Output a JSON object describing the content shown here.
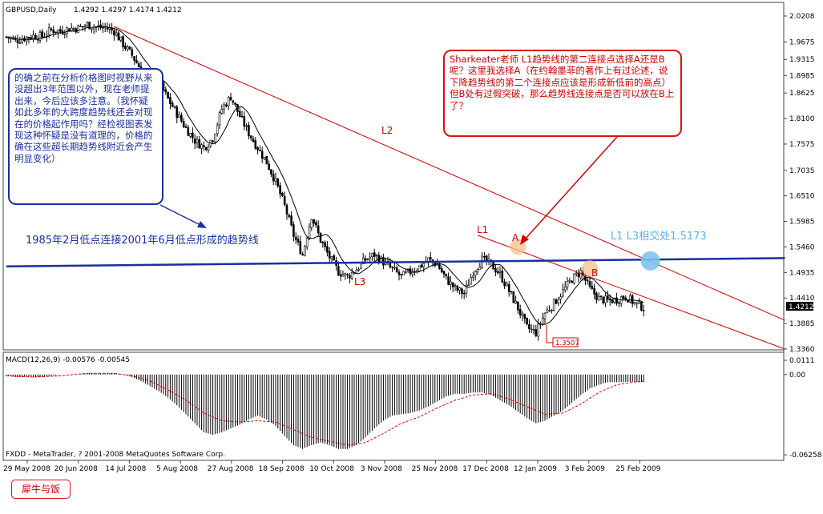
{
  "window": {
    "title": "GBPUSD,Daily",
    "ohlc": "1.4292 1.4297 1.4174 1.4212",
    "current_price": "1.4212",
    "footer": "FXDD - MetaTrader, ? 2001-2008 MetaQuotes Software Corp."
  },
  "annotations": {
    "left_note": "的确之前在分析价格图时视野从来没超出3年范围以外，现在老师提出来，今后应该多注意。（我怀疑如此多年的大跨度趋势线还会对现在的价格起作用吗？经检视图表发现这种怀疑是没有道理的，价格的确在这些超长期趋势线附近会产生明显变化）",
    "right_note": "Sharkeater老师 L1趋势线的第二连接点选择A还是B呢？这里我选择A（在约翰墨菲的著作上有过论述，说下降趋势线的第二个连接点应该是形成新低前的高点）但B处有过假突破，那么趋势线连接点是否可以放在B上了？",
    "blue_line_label": "1985年2月低点连接2001年6月低点形成的趋势线",
    "intersection_label": "L1 L3相交处1.5173",
    "label_L1": "L1",
    "label_L2": "L2",
    "label_L3": "L3",
    "label_A": "A",
    "label_B": "B",
    "low_label": "1.3507",
    "signature": "犀牛与饭"
  },
  "colors": {
    "bull_candle": "#ffffff",
    "bear_candle": "#000000",
    "moving_average": "#000000",
    "trend_red": "#d40000",
    "trend_blue": "#1a2fa0",
    "intersection": "#7ec3ef",
    "highlight": "#f5c08a",
    "macd_signal": "#e00000"
  },
  "chart_data": [
    {
      "type": "candlestick",
      "title": "GBPUSD,Daily",
      "ylim": [
        1.336,
        2.0208
      ],
      "y_ticks": [
        "2.0208",
        "1.9675",
        "1.9315",
        "1.8985",
        "1.8625",
        "1.8100",
        "1.7575",
        "1.7035",
        "1.6510",
        "1.5985",
        "1.5460",
        "1.4935",
        "1.4410",
        "1.3885",
        "1.3360"
      ],
      "x_ticks": [
        "29 May 2008",
        "20 Jun 2008",
        "14 Jul 2008",
        "5 Aug 2008",
        "27 Aug 2008",
        "18 Sep 2008",
        "10 Oct 2008",
        "3 Nov 2008",
        "25 Nov 2008",
        "17 Dec 2008",
        "12 Jan 2009",
        "3 Feb 2009",
        "25 Feb 2009"
      ],
      "close_path": [
        [
          0,
          1.978
        ],
        [
          4,
          1.97
        ],
        [
          8,
          1.976
        ],
        [
          12,
          1.98
        ],
        [
          16,
          1.979
        ],
        [
          20,
          1.992
        ],
        [
          24,
          1.99
        ],
        [
          28,
          1.995
        ],
        [
          32,
          1.996
        ],
        [
          36,
          2.003
        ],
        [
          40,
          1.998
        ],
        [
          44,
          1.997
        ],
        [
          48,
          1.99
        ],
        [
          52,
          1.963
        ],
        [
          56,
          1.94
        ],
        [
          60,
          1.91
        ],
        [
          64,
          1.885
        ],
        [
          68,
          1.885
        ],
        [
          72,
          1.85
        ],
        [
          76,
          1.82
        ],
        [
          80,
          1.79
        ],
        [
          84,
          1.765
        ],
        [
          88,
          1.75
        ],
        [
          92,
          1.77
        ],
        [
          96,
          1.83
        ],
        [
          100,
          1.855
        ],
        [
          104,
          1.815
        ],
        [
          108,
          1.78
        ],
        [
          112,
          1.75
        ],
        [
          116,
          1.72
        ],
        [
          120,
          1.68
        ],
        [
          124,
          1.63
        ],
        [
          128,
          1.57
        ],
        [
          132,
          1.53
        ],
        [
          136,
          1.61
        ],
        [
          140,
          1.56
        ],
        [
          144,
          1.525
        ],
        [
          148,
          1.495
        ],
        [
          152,
          1.485
        ],
        [
          156,
          1.5
        ],
        [
          160,
          1.52
        ],
        [
          164,
          1.53
        ],
        [
          168,
          1.515
        ],
        [
          172,
          1.5
        ],
        [
          176,
          1.485
        ],
        [
          180,
          1.495
        ],
        [
          184,
          1.505
        ],
        [
          188,
          1.52
        ],
        [
          192,
          1.51
        ],
        [
          196,
          1.48
        ],
        [
          200,
          1.46
        ],
        [
          204,
          1.45
        ],
        [
          208,
          1.495
        ],
        [
          212,
          1.52
        ],
        [
          216,
          1.51
        ],
        [
          220,
          1.49
        ],
        [
          224,
          1.455
        ],
        [
          228,
          1.42
        ],
        [
          232,
          1.38
        ],
        [
          236,
          1.37
        ],
        [
          240,
          1.41
        ],
        [
          244,
          1.43
        ],
        [
          248,
          1.455
        ],
        [
          252,
          1.48
        ],
        [
          256,
          1.495
        ],
        [
          260,
          1.46
        ],
        [
          264,
          1.44
        ],
        [
          268,
          1.435
        ],
        [
          272,
          1.438
        ],
        [
          276,
          1.445
        ],
        [
          280,
          1.43
        ],
        [
          284,
          1.4212
        ]
      ],
      "trendlines": [
        {
          "name": "L1",
          "from": [
            210,
            1.57
          ],
          "to": [
            347,
            1.336
          ]
        },
        {
          "name": "L2",
          "from": [
            48,
            1.999
          ],
          "to": [
            347,
            1.395
          ]
        },
        {
          "name": "L3",
          "from": [
            0,
            1.506
          ],
          "to": [
            347,
            1.523
          ]
        }
      ],
      "points": [
        {
          "name": "A",
          "x": 228,
          "y": 1.546
        },
        {
          "name": "B",
          "x": 260,
          "y": 1.502
        },
        {
          "name": "L1 L3 intersection",
          "x": 287,
          "y": 1.5173
        },
        {
          "name": "low",
          "x": 244,
          "y": 1.3507
        }
      ]
    },
    {
      "type": "bar",
      "title": "MACD(12,26,9) -0.00576 -0.00545",
      "ylim": [
        -0.0625,
        0.0111
      ],
      "y_ticks": [
        "0.0111",
        "0.00",
        "-0.06258"
      ],
      "histogram": [
        [
          0,
          -0.001
        ],
        [
          4,
          -0.002
        ],
        [
          8,
          -0.002
        ],
        [
          12,
          -0.002
        ],
        [
          16,
          -0.002
        ],
        [
          20,
          -0.001
        ],
        [
          24,
          0
        ],
        [
          28,
          0
        ],
        [
          32,
          0
        ],
        [
          36,
          0.001
        ],
        [
          40,
          0.001
        ],
        [
          44,
          0.001
        ],
        [
          48,
          0.001
        ],
        [
          52,
          0
        ],
        [
          56,
          -0.002
        ],
        [
          60,
          -0.005
        ],
        [
          64,
          -0.009
        ],
        [
          68,
          -0.013
        ],
        [
          72,
          -0.018
        ],
        [
          76,
          -0.024
        ],
        [
          80,
          -0.031
        ],
        [
          84,
          -0.038
        ],
        [
          88,
          -0.045
        ],
        [
          92,
          -0.047
        ],
        [
          96,
          -0.045
        ],
        [
          100,
          -0.042
        ],
        [
          104,
          -0.039
        ],
        [
          108,
          -0.035
        ],
        [
          112,
          -0.032
        ],
        [
          116,
          -0.035
        ],
        [
          120,
          -0.04
        ],
        [
          124,
          -0.048
        ],
        [
          128,
          -0.055
        ],
        [
          132,
          -0.058
        ],
        [
          136,
          -0.055
        ],
        [
          140,
          -0.053
        ],
        [
          144,
          -0.055
        ],
        [
          148,
          -0.058
        ],
        [
          152,
          -0.058
        ],
        [
          156,
          -0.055
        ],
        [
          160,
          -0.049
        ],
        [
          164,
          -0.042
        ],
        [
          168,
          -0.036
        ],
        [
          172,
          -0.032
        ],
        [
          176,
          -0.031
        ],
        [
          180,
          -0.03
        ],
        [
          184,
          -0.028
        ],
        [
          188,
          -0.025
        ],
        [
          192,
          -0.021
        ],
        [
          196,
          -0.017
        ],
        [
          200,
          -0.015
        ],
        [
          204,
          -0.015
        ],
        [
          208,
          -0.014
        ],
        [
          212,
          -0.014
        ],
        [
          216,
          -0.016
        ],
        [
          220,
          -0.02
        ],
        [
          224,
          -0.024
        ],
        [
          228,
          -0.029
        ],
        [
          232,
          -0.034
        ],
        [
          236,
          -0.038
        ],
        [
          240,
          -0.036
        ],
        [
          244,
          -0.032
        ],
        [
          248,
          -0.028
        ],
        [
          252,
          -0.022
        ],
        [
          256,
          -0.016
        ],
        [
          260,
          -0.011
        ],
        [
          264,
          -0.008
        ],
        [
          268,
          -0.006
        ],
        [
          272,
          -0.006
        ],
        [
          276,
          -0.0058
        ],
        [
          280,
          -0.0057
        ],
        [
          284,
          -0.0058
        ]
      ],
      "signal": [
        [
          0,
          -0.001
        ],
        [
          12,
          -0.002
        ],
        [
          24,
          -0.001
        ],
        [
          36,
          0.001
        ],
        [
          48,
          0.001
        ],
        [
          56,
          -0.001
        ],
        [
          64,
          -0.005
        ],
        [
          72,
          -0.012
        ],
        [
          80,
          -0.02
        ],
        [
          88,
          -0.03
        ],
        [
          96,
          -0.036
        ],
        [
          104,
          -0.037
        ],
        [
          112,
          -0.036
        ],
        [
          120,
          -0.037
        ],
        [
          128,
          -0.043
        ],
        [
          136,
          -0.049
        ],
        [
          144,
          -0.052
        ],
        [
          152,
          -0.055
        ],
        [
          160,
          -0.053
        ],
        [
          168,
          -0.046
        ],
        [
          176,
          -0.038
        ],
        [
          184,
          -0.033
        ],
        [
          192,
          -0.026
        ],
        [
          200,
          -0.02
        ],
        [
          208,
          -0.016
        ],
        [
          216,
          -0.015
        ],
        [
          224,
          -0.019
        ],
        [
          232,
          -0.025
        ],
        [
          240,
          -0.031
        ],
        [
          248,
          -0.03
        ],
        [
          256,
          -0.023
        ],
        [
          264,
          -0.014
        ],
        [
          272,
          -0.008
        ],
        [
          280,
          -0.0058
        ],
        [
          284,
          -0.00545
        ]
      ]
    }
  ]
}
